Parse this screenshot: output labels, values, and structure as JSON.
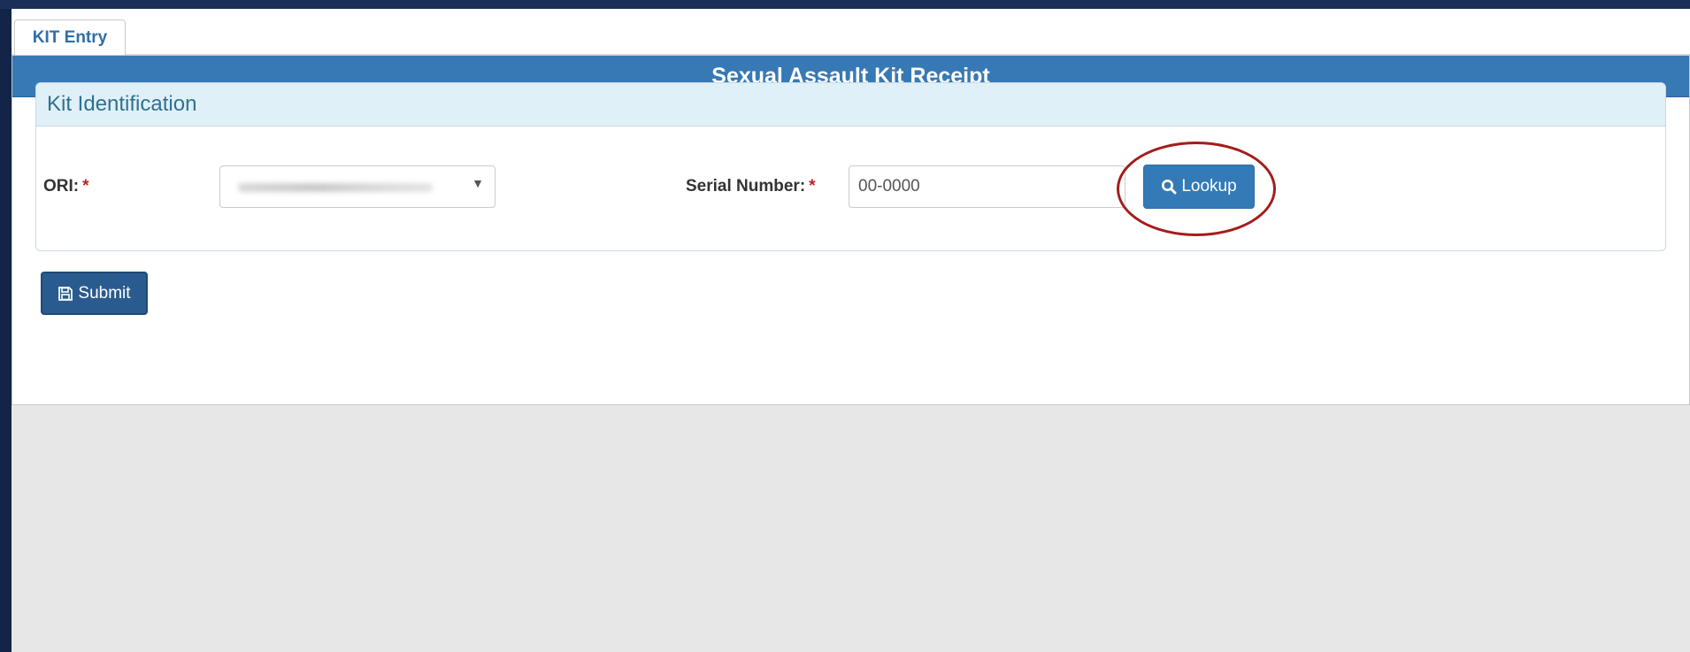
{
  "tab": {
    "label": "KIT Entry"
  },
  "panel": {
    "title": "Sexual Assault Kit Receipt"
  },
  "kit_identification": {
    "legend": "Kit Identification",
    "ori_label": "ORI:",
    "ori_required": "*",
    "serial_label": "Serial Number:",
    "serial_required": "*",
    "serial_placeholder": "00-0000"
  },
  "buttons": {
    "lookup": "Lookup",
    "submit": "Submit"
  },
  "icons": {
    "lookup": "search-icon",
    "submit": "save-icon",
    "select": "dropdown-arrow-icon"
  },
  "colors": {
    "primary": "#337ab7",
    "header": "#3779b5",
    "highlight": "#a41c1c"
  }
}
